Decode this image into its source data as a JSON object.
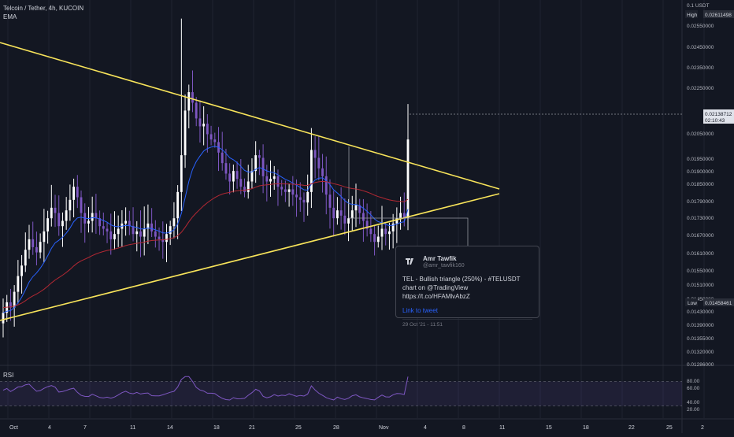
{
  "legend": {
    "symbol": "Telcoin / Tether, 4h, KUCOIN",
    "indicator": "EMA"
  },
  "rsi_label": "RSI",
  "price_axis": {
    "unit": "0.1 USDT",
    "ticks": [
      "0.02550000",
      "0.02450000",
      "0.02350000",
      "0.02250000",
      "0.02050000",
      "0.01950000",
      "0.01900000",
      "0.01850000",
      "0.01790000",
      "0.01730000",
      "0.01670000",
      "0.01610000",
      "0.01550000",
      "0.01510000",
      "0.01450000",
      "0.01430000",
      "0.01390000",
      "0.01355000",
      "0.01320000",
      "0.01286000"
    ],
    "high": {
      "label": "High",
      "value": "0.02611498"
    },
    "low": {
      "label": "Low",
      "value": "0.01458461"
    },
    "last": {
      "value": "0.02138712",
      "countdown": "02:10:43"
    }
  },
  "rsi_axis": {
    "ticks": [
      "80.00",
      "60.00",
      "40.00",
      "20.00"
    ]
  },
  "time_axis": {
    "ticks": [
      "Oct",
      "4",
      "7",
      "11",
      "14",
      "18",
      "21",
      "25",
      "28",
      "Nov",
      "4",
      "8",
      "11",
      "15",
      "18",
      "22",
      "25",
      "2"
    ]
  },
  "tweet": {
    "author": "Amr Tawfik",
    "handle": "@amr_tawfik160",
    "text": "TEL - Bullish triangle (250%) - #TELUSDT chart on @TradingView https://t.co/HFAMlvAbzZ",
    "link": "Link to tweet",
    "date": "29 Oct '21 - 11:51"
  },
  "colors": {
    "background": "#131722",
    "bull": "#ffffff",
    "bear": "#7e57c2",
    "trendline": "#f7e35a",
    "ema_fast": "#2962ff",
    "ema_slow": "#b22833",
    "rsi_line": "#7e57c2",
    "rsi_band": "#7e57c2",
    "grid": "#1f2330"
  },
  "chart_data": {
    "type": "candlestick",
    "price_range": [
      0.01286,
      0.02611
    ],
    "close_series": [
      0.0148,
      0.0152,
      0.015,
      0.0156,
      0.0162,
      0.0166,
      0.0172,
      0.0176,
      0.0173,
      0.0171,
      0.0175,
      0.0179,
      0.0184,
      0.0188,
      0.0186,
      0.0181,
      0.0183,
      0.0187,
      0.0191,
      0.0196,
      0.0192,
      0.0186,
      0.0182,
      0.0183,
      0.0186,
      0.0184,
      0.0181,
      0.018,
      0.0179,
      0.0176,
      0.0178,
      0.018,
      0.0182,
      0.0183,
      0.0181,
      0.0178,
      0.0179,
      0.0177,
      0.018,
      0.0182,
      0.0179,
      0.0177,
      0.0176,
      0.0175,
      0.0178,
      0.0181,
      0.0184,
      0.0194,
      0.0208,
      0.0225,
      0.0232,
      0.0228,
      0.0222,
      0.0219,
      0.022,
      0.0216,
      0.0214,
      0.0213,
      0.0209,
      0.0205,
      0.0201,
      0.0198,
      0.0202,
      0.0199,
      0.0196,
      0.0194,
      0.0198,
      0.0202,
      0.0208,
      0.0207,
      0.02,
      0.0198,
      0.0199,
      0.02,
      0.0196,
      0.0195,
      0.0194,
      0.0195,
      0.0193,
      0.0192,
      0.0191,
      0.019,
      0.0194,
      0.021,
      0.0207,
      0.0203,
      0.02,
      0.0193,
      0.0188,
      0.0184,
      0.0187,
      0.0185,
      0.0182,
      0.0184,
      0.0187,
      0.0189,
      0.0186,
      0.0183,
      0.018,
      0.0178,
      0.0175,
      0.0177,
      0.018,
      0.0178,
      0.0179,
      0.0182,
      0.0184,
      0.0186,
      0.0184,
      0.0214
    ],
    "trendlines": [
      {
        "from": [
          0,
          0.0248
        ],
        "to": [
          634,
          0.0186
        ]
      },
      {
        "from": [
          0,
          0.01425
        ],
        "to": [
          634,
          0.01845
        ]
      }
    ],
    "rsi_range": [
      20,
      80
    ]
  }
}
